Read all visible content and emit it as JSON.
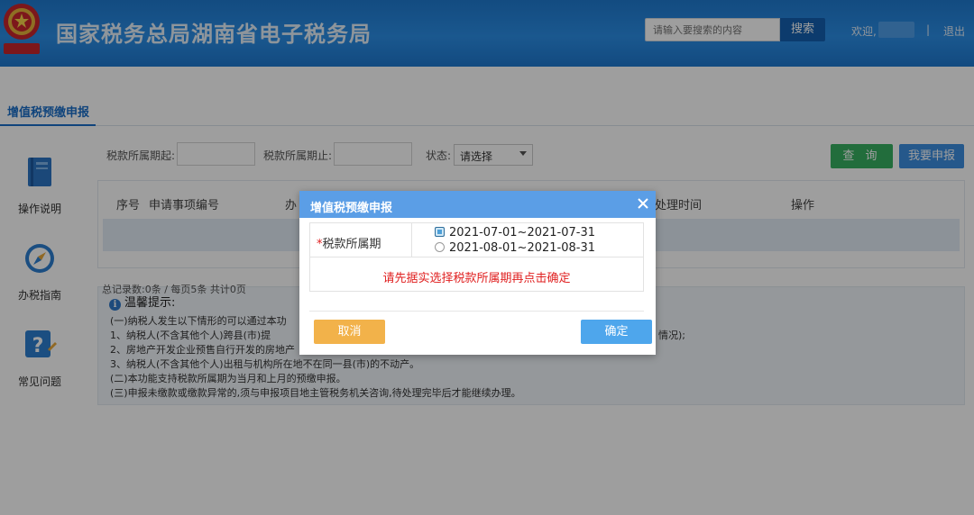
{
  "header": {
    "title": "国家税务总局湖南省电子税务局",
    "search_placeholder": "请输入要搜索的内容",
    "search_button": "搜索",
    "welcome": "欢迎,",
    "separator": "|",
    "logout": "退出"
  },
  "tabs": [
    {
      "label": "增值税预缴申报",
      "active": true
    }
  ],
  "sidebar": {
    "items": [
      {
        "label": "操作说明",
        "icon": "book-icon"
      },
      {
        "label": "办税指南",
        "icon": "compass-icon"
      },
      {
        "label": "常见问题",
        "icon": "question-icon"
      }
    ]
  },
  "filters": {
    "start_label": "税款所属期起:",
    "start_value": "",
    "end_label": "税款所属期止:",
    "end_value": "",
    "status_label": "状态:",
    "status_value": "请选择",
    "query_button": "查 询",
    "declare_button": "我要申报"
  },
  "table": {
    "columns": [
      "序号",
      "申请事项编号",
      "办",
      "处理时间",
      "操作"
    ],
    "rows": []
  },
  "pager": "总记录数:0条 / 每页5条 共计0页",
  "tips": {
    "title": "温馨提示:",
    "lines": [
      "(一)纳税人发生以下情形的可以通过本功",
      "1、纳税人(不含其他个人)跨县(市)提",
      "2、房地产开发企业预售自行开发的房地产",
      "3、纳税人(不含其他个人)出租与机构所在地不在同一县(市)的不动产。",
      "(二)本功能支持税款所属期为当月和上月的预缴申报。",
      "(三)申报未缴款或缴款异常的,须与申报项目地主管税务机关咨询,待处理完毕后才能继续办理。"
    ],
    "line2_tail": "情况);"
  },
  "modal": {
    "title": "增值税预缴申报",
    "required_mark": "*",
    "field_label": "税款所属期",
    "options": [
      {
        "label": "2021-07-01~2021-07-31",
        "checked": true
      },
      {
        "label": "2021-08-01~2021-08-31",
        "checked": false
      }
    ],
    "warning": "请先据实选择税款所属期再点击确定",
    "cancel_button": "取消",
    "ok_button": "确定"
  },
  "colors": {
    "header_blue": "#2b8ee6",
    "query_green": "#38b062",
    "declare_blue": "#3d8fe0",
    "cancel_orange": "#f2b24a",
    "ok_blue": "#4ea6ec",
    "warning_red": "#e02020"
  }
}
